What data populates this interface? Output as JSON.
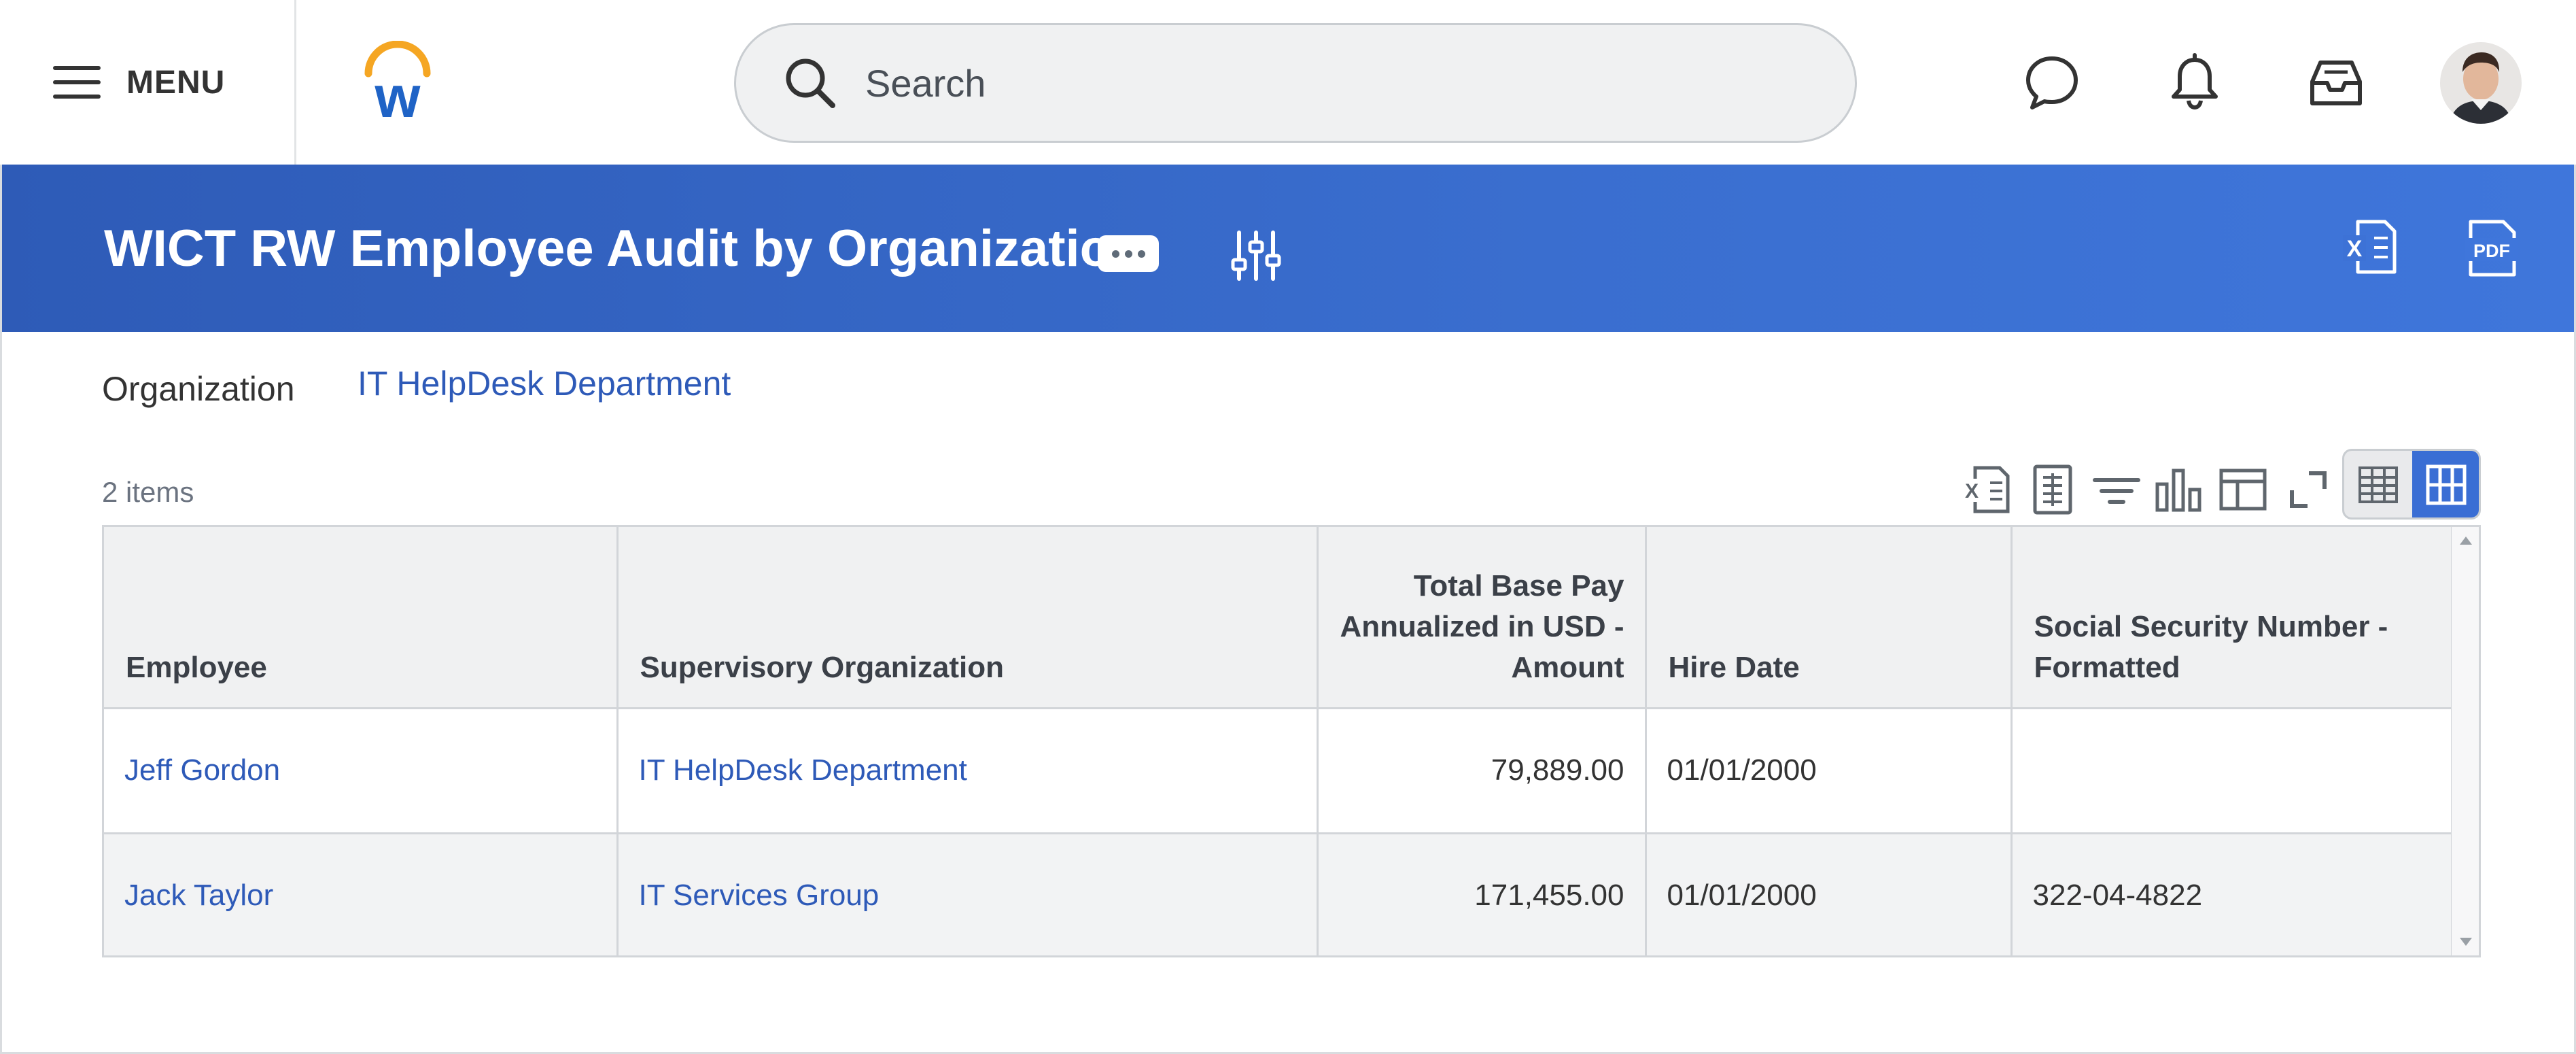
{
  "topbar": {
    "menu_label": "MENU",
    "search_placeholder": "Search"
  },
  "header": {
    "title": "WICT RW Employee Audit by Organization"
  },
  "filters": {
    "organization_label": "Organization",
    "organization_value": "IT HelpDesk Department"
  },
  "grid": {
    "items_count": "2 items",
    "columns": [
      "Employee",
      "Supervisory Organization",
      "Total Base Pay Annualized in USD - Amount",
      "Hire Date",
      "Social Security Number - Formatted"
    ],
    "rows": [
      {
        "employee": "Jeff Gordon",
        "supervisory_org": "IT HelpDesk Department",
        "base_pay": "79,889.00",
        "hire_date": "01/01/2000",
        "ssn": ""
      },
      {
        "employee": "Jack Taylor",
        "supervisory_org": "IT Services Group",
        "base_pay": "171,455.00",
        "hire_date": "01/01/2000",
        "ssn": "322-04-4822"
      }
    ]
  },
  "icons": {
    "menu": "hamburger-icon",
    "search": "search-icon",
    "chat": "chat-icon",
    "notifications": "bell-icon",
    "inbox": "inbox-icon",
    "related_actions": "sliders-icon",
    "export_excel": "excel-icon",
    "export_pdf": "pdf-icon"
  },
  "colors": {
    "brand_blue": "#3a6ed4",
    "header_gradient_start": "#2e5bb7",
    "header_gradient_end": "#3f76db",
    "link_blue": "#2e5ab8",
    "logo_orange": "#f5a623",
    "logo_blue": "#1f63c6"
  }
}
